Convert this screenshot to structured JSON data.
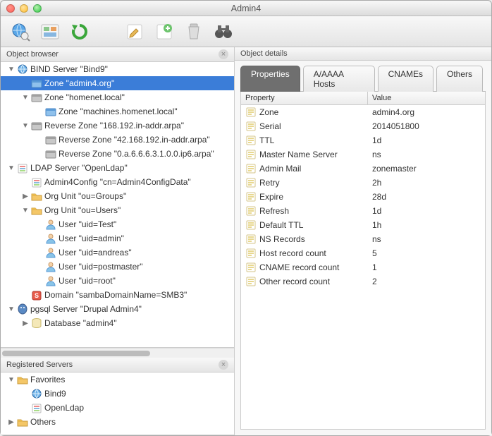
{
  "window": {
    "title": "Admin4"
  },
  "panels": {
    "object_browser": "Object browser",
    "registered_servers": "Registered Servers",
    "object_details": "Object details"
  },
  "tabs": {
    "properties": "Properties",
    "aaaaa": "A/AAAA Hosts",
    "cnames": "CNAMEs",
    "others": "Others"
  },
  "table_head": {
    "property": "Property",
    "value": "Value"
  },
  "tree": {
    "n0": "BIND Server \"Bind9\"",
    "n1": "Zone \"admin4.org\"",
    "n2": "Zone \"homenet.local\"",
    "n3": "Zone \"machines.homenet.local\"",
    "n4": "Reverse Zone \"168.192.in-addr.arpa\"",
    "n5": "Reverse Zone \"42.168.192.in-addr.arpa\"",
    "n6": "Reverse Zone \"0.a.6.6.6.3.1.0.0.ip6.arpa\"",
    "n7": "LDAP Server \"OpenLdap\"",
    "n8": "Admin4Config \"cn=Admin4ConfigData\"",
    "n9": "Org Unit \"ou=Groups\"",
    "n10": "Org Unit \"ou=Users\"",
    "n11": "User \"uid=Test\"",
    "n12": "User \"uid=admin\"",
    "n13": "User \"uid=andreas\"",
    "n14": "User \"uid=postmaster\"",
    "n15": "User \"uid=root\"",
    "n16": "Domain \"sambaDomainName=SMB3\"",
    "n17": "pgsql Server \"Drupal Admin4\"",
    "n18": "Database \"admin4\""
  },
  "registered": {
    "fav": "Favorites",
    "bind9": "Bind9",
    "openldap": "OpenLdap",
    "others": "Others"
  },
  "properties": [
    {
      "name": "Zone",
      "value": "admin4.org"
    },
    {
      "name": "Serial",
      "value": "2014051800"
    },
    {
      "name": "TTL",
      "value": "1d"
    },
    {
      "name": "Master Name Server",
      "value": "ns"
    },
    {
      "name": "Admin Mail",
      "value": "zonemaster"
    },
    {
      "name": "Retry",
      "value": "2h"
    },
    {
      "name": "Expire",
      "value": "28d"
    },
    {
      "name": "Refresh",
      "value": "1d"
    },
    {
      "name": "Default TTL",
      "value": "1h"
    },
    {
      "name": "NS Records",
      "value": "ns"
    },
    {
      "name": "Host record count",
      "value": "5"
    },
    {
      "name": "CNAME record count",
      "value": "1"
    },
    {
      "name": "Other record count",
      "value": "2"
    }
  ]
}
